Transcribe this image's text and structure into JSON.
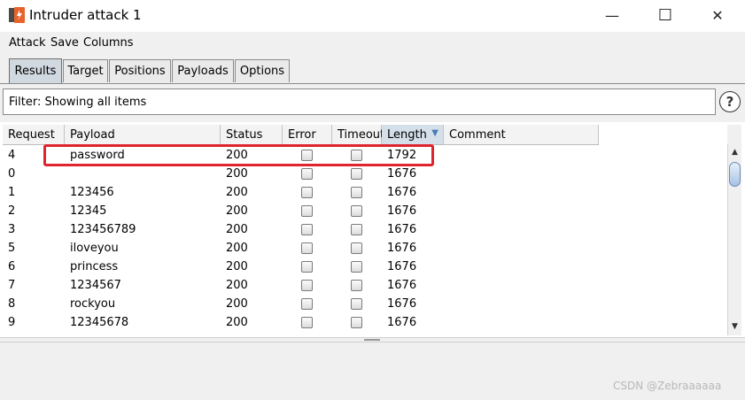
{
  "window": {
    "title": "Intruder attack 1",
    "controls": {
      "minimize": "—",
      "maximize": "☐",
      "close": "✕"
    }
  },
  "menu": [
    "Attack",
    "Save",
    "Columns"
  ],
  "tabs": [
    {
      "label": "Results",
      "active": true
    },
    {
      "label": "Target",
      "active": false
    },
    {
      "label": "Positions",
      "active": false
    },
    {
      "label": "Payloads",
      "active": false
    },
    {
      "label": "Options",
      "active": false
    }
  ],
  "filter": {
    "text": "Filter: Showing all items",
    "help": "?"
  },
  "table": {
    "columns": [
      "Request",
      "Payload",
      "Status",
      "Error",
      "Timeout",
      "Length",
      "Comment"
    ],
    "sorted_column": "Length",
    "sort_indicator": "▼",
    "rows": [
      {
        "request": "4",
        "payload": "password",
        "status": "200",
        "error": false,
        "timeout": false,
        "length": "1792",
        "comment": ""
      },
      {
        "request": "0",
        "payload": "",
        "status": "200",
        "error": false,
        "timeout": false,
        "length": "1676",
        "comment": ""
      },
      {
        "request": "1",
        "payload": "123456",
        "status": "200",
        "error": false,
        "timeout": false,
        "length": "1676",
        "comment": ""
      },
      {
        "request": "2",
        "payload": "12345",
        "status": "200",
        "error": false,
        "timeout": false,
        "length": "1676",
        "comment": ""
      },
      {
        "request": "3",
        "payload": "123456789",
        "status": "200",
        "error": false,
        "timeout": false,
        "length": "1676",
        "comment": ""
      },
      {
        "request": "5",
        "payload": "iloveyou",
        "status": "200",
        "error": false,
        "timeout": false,
        "length": "1676",
        "comment": ""
      },
      {
        "request": "6",
        "payload": "princess",
        "status": "200",
        "error": false,
        "timeout": false,
        "length": "1676",
        "comment": ""
      },
      {
        "request": "7",
        "payload": "1234567",
        "status": "200",
        "error": false,
        "timeout": false,
        "length": "1676",
        "comment": ""
      },
      {
        "request": "8",
        "payload": "rockyou",
        "status": "200",
        "error": false,
        "timeout": false,
        "length": "1676",
        "comment": ""
      },
      {
        "request": "9",
        "payload": "12345678",
        "status": "200",
        "error": false,
        "timeout": false,
        "length": "1676",
        "comment": ""
      }
    ]
  },
  "scrollbar": {
    "up": "▲",
    "down": "▼"
  },
  "watermark": "CSDN @Zebraaaaaa",
  "colors": {
    "highlight_border": "#e0242e",
    "app_icon": "#e8622c",
    "sort_header": "#d5dfe9"
  }
}
